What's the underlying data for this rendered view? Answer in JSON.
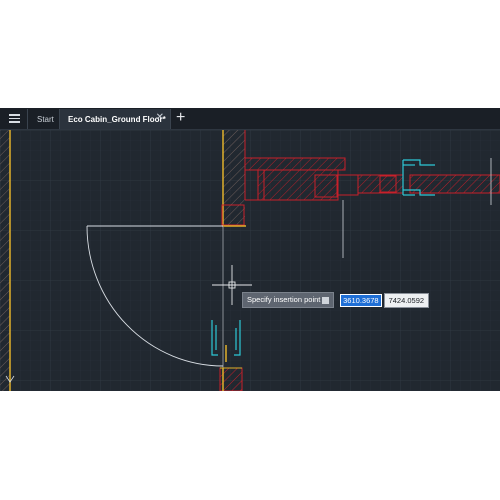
{
  "tabs": {
    "menu_icon": "hamburger-menu-icon",
    "start_label": "Start",
    "active_label": "Eco Cabin_Ground Floor*",
    "close_glyph": "✕",
    "add_glyph": "+"
  },
  "command": {
    "prompt": "Specify insertion point or",
    "icon": "arrow-down-icon",
    "x_value": "3610.3678",
    "y_value": "7424.0592"
  },
  "colors": {
    "background": "#212830",
    "wall_hatch": "#c8202a",
    "wall_outline_yellow": "#e0b02a",
    "fixture_cyan": "#2ec8d6",
    "grid": "#2c343e"
  }
}
